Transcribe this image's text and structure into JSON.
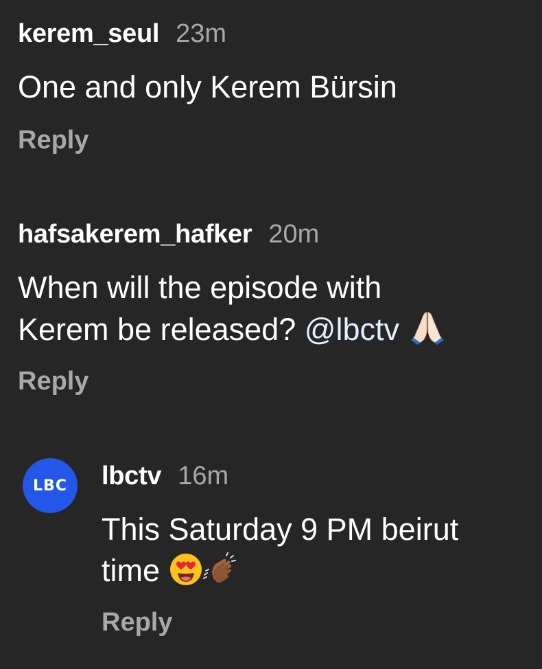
{
  "comments": [
    {
      "username": "kerem_seul",
      "time": "23m",
      "text": "One and only Kerem Bürsin",
      "reply_label": "Reply"
    },
    {
      "username": "hafsakerem_hafker",
      "time": "20m",
      "text_line1": "When will the episode with",
      "text_line2": "Kerem be released?",
      "mention": "@lbctv",
      "emoji": "folded-hands",
      "reply_label": "Reply"
    },
    {
      "username": "lbctv",
      "avatar_text": "LBC",
      "time": "16m",
      "text_line1": "This Saturday 9 PM beirut",
      "text_line2": "time",
      "emojis": [
        "heart-eyes",
        "clapping-hands"
      ],
      "reply_label": "Reply"
    }
  ],
  "colors": {
    "background": "#262626",
    "text": "#ffffff",
    "muted": "#a8a8a8",
    "mention": "#e0f1ff",
    "avatar": "#2456e8"
  }
}
